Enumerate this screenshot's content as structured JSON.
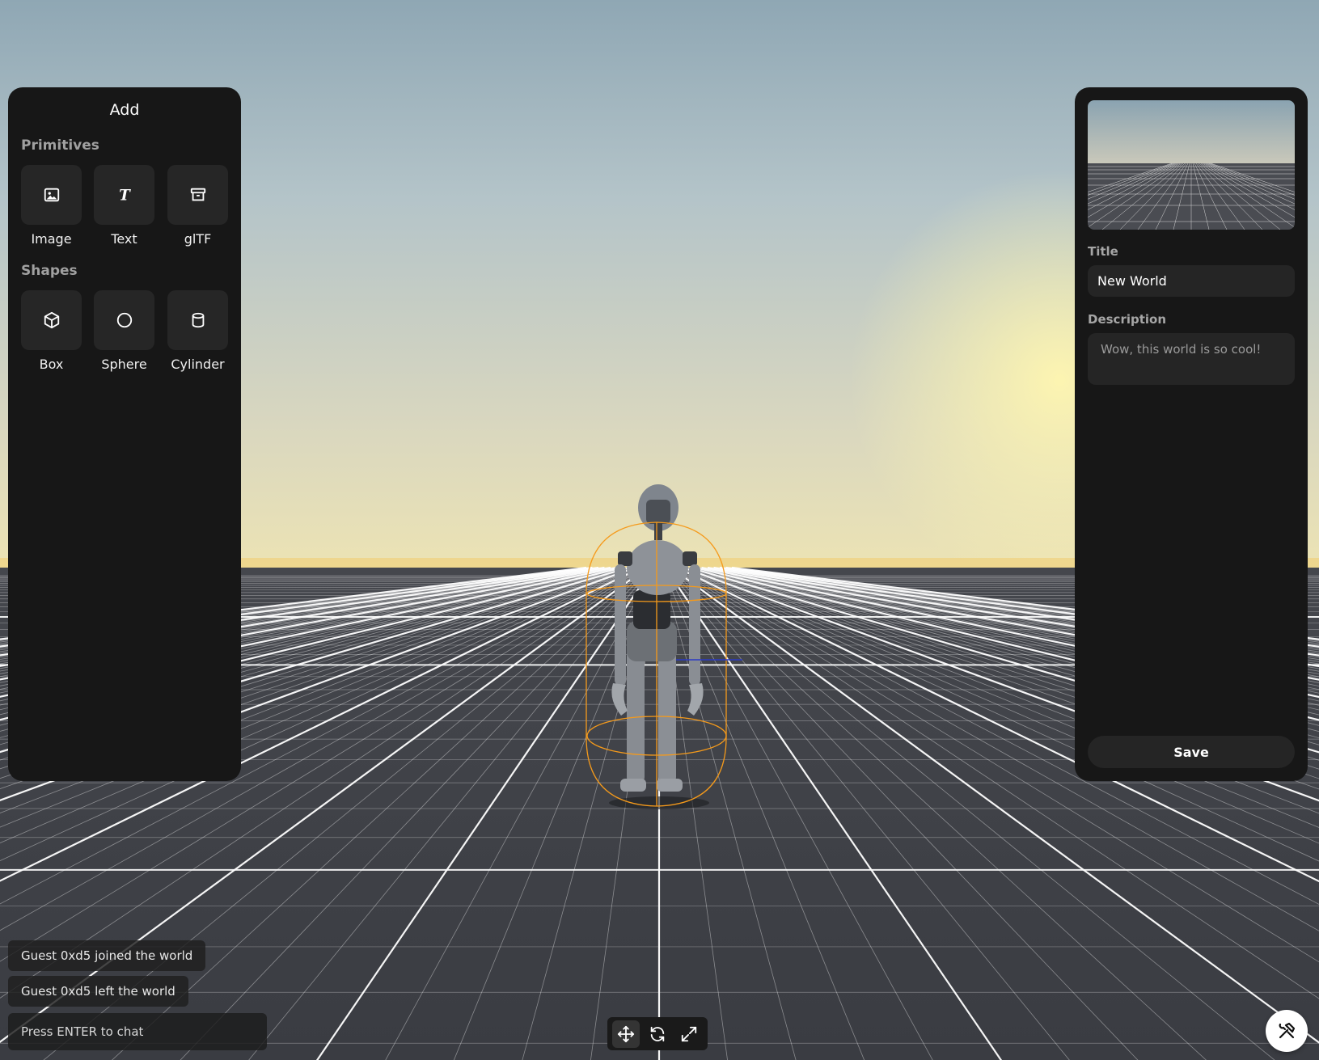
{
  "add_panel": {
    "title": "Add",
    "primitives_label": "Primitives",
    "primitives": [
      {
        "label": "Image",
        "icon": "image-icon"
      },
      {
        "label": "Text",
        "icon": "text-icon"
      },
      {
        "label": "glTF",
        "icon": "archive-icon"
      }
    ],
    "shapes_label": "Shapes",
    "shapes": [
      {
        "label": "Box",
        "icon": "box-icon"
      },
      {
        "label": "Sphere",
        "icon": "sphere-icon"
      },
      {
        "label": "Cylinder",
        "icon": "cylinder-icon"
      }
    ]
  },
  "world_panel": {
    "title_label": "Title",
    "title_value": "New World",
    "description_label": "Description",
    "description_placeholder": "Wow, this world is so cool!",
    "save_label": "Save"
  },
  "chat": {
    "messages": [
      "Guest 0xd5 joined the world",
      "Guest 0xd5 left the world"
    ],
    "input_placeholder": "Press ENTER to chat"
  },
  "gizmo_toolbar": {
    "tools": [
      {
        "icon": "move-icon",
        "active": true
      },
      {
        "icon": "rotate-icon",
        "active": false
      },
      {
        "icon": "scale-icon",
        "active": false
      }
    ]
  },
  "build_toggle_icon": "hammer-wrench-icon",
  "colors": {
    "panel_bg": "#171717",
    "tile_bg": "#262626",
    "ground": "#3d3f45",
    "grid_line": "#ffffff",
    "selection": "#f59a1b"
  }
}
